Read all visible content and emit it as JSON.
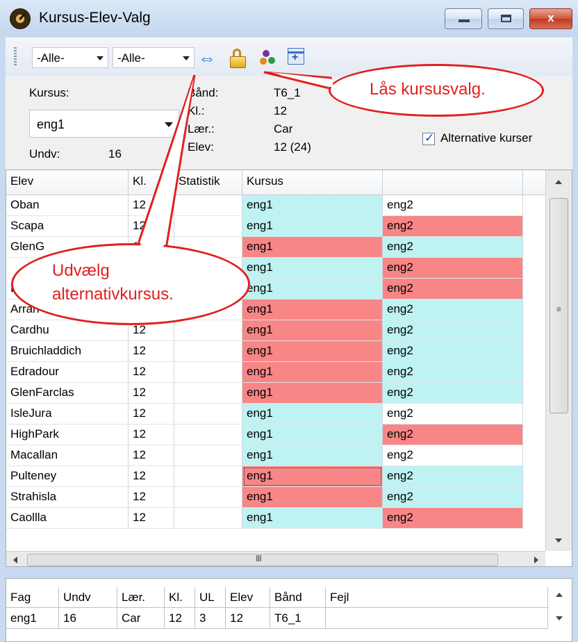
{
  "window": {
    "title": "Kursus-Elev-Valg",
    "close_glyph": "x"
  },
  "toolbar": {
    "filter1": "-Alle-",
    "filter2": "-Alle-",
    "icons": [
      "swap-arrows-icon",
      "lock-icon",
      "users-icon",
      "grid-expand-icon"
    ]
  },
  "info": {
    "kursus_label": "Kursus:",
    "kursus_value": "eng1",
    "undv_label": "Undv:",
    "undv_value": "16",
    "band_label": "Bånd:",
    "band_value": "T6_1",
    "kl_label": "Kl.:",
    "kl_value": "12",
    "laer_label": "Lær.:",
    "laer_value": "Car",
    "elev_label": "Elev:",
    "elev_value": "12 (24)",
    "alt_checkbox_label": "Alternative kurser",
    "alt_checked": true
  },
  "grid": {
    "headers": [
      "Elev",
      "Kl.",
      "Statistik",
      "Kursus",
      ""
    ],
    "rows": [
      {
        "elev": "Oban",
        "kl": "12",
        "stat": "",
        "kursus": "eng1",
        "alt": "eng2",
        "c1": "cyan",
        "c2": "white"
      },
      {
        "elev": "Scapa",
        "kl": "12",
        "stat": "",
        "kursus": "eng1",
        "alt": "eng2",
        "c1": "cyan",
        "c2": "red"
      },
      {
        "elev": "GlenG",
        "kl": "12",
        "stat": "",
        "kursus": "eng1",
        "alt": "eng2",
        "c1": "red",
        "c2": "cyan"
      },
      {
        "elev": "",
        "kl": "12",
        "stat": "",
        "kursus": "eng1",
        "alt": "eng2",
        "c1": "cyan",
        "c2": "red"
      },
      {
        "elev": "B",
        "kl": "12",
        "stat": "",
        "kursus": "eng1",
        "alt": "eng2",
        "c1": "cyan",
        "c2": "red"
      },
      {
        "elev": "Arran",
        "kl": "12",
        "stat": "",
        "kursus": "eng1",
        "alt": "eng2",
        "c1": "red",
        "c2": "cyan"
      },
      {
        "elev": "Cardhu",
        "kl": "12",
        "stat": "",
        "kursus": "eng1",
        "alt": "eng2",
        "c1": "red",
        "c2": "cyan"
      },
      {
        "elev": "Bruichladdich",
        "kl": "12",
        "stat": "",
        "kursus": "eng1",
        "alt": "eng2",
        "c1": "red",
        "c2": "cyan"
      },
      {
        "elev": "Edradour",
        "kl": "12",
        "stat": "",
        "kursus": "eng1",
        "alt": "eng2",
        "c1": "red",
        "c2": "cyan"
      },
      {
        "elev": "GlenFarclas",
        "kl": "12",
        "stat": "",
        "kursus": "eng1",
        "alt": "eng2",
        "c1": "red",
        "c2": "cyan"
      },
      {
        "elev": "IsleJura",
        "kl": "12",
        "stat": "",
        "kursus": "eng1",
        "alt": "eng2",
        "c1": "cyan",
        "c2": "white"
      },
      {
        "elev": "HighPark",
        "kl": "12",
        "stat": "",
        "kursus": "eng1",
        "alt": "eng2",
        "c1": "cyan",
        "c2": "red"
      },
      {
        "elev": "Macallan",
        "kl": "12",
        "stat": "",
        "kursus": "eng1",
        "alt": "eng2",
        "c1": "cyan",
        "c2": "white"
      },
      {
        "elev": "Pulteney",
        "kl": "12",
        "stat": "",
        "kursus": "eng1",
        "alt": "eng2",
        "c1": "red",
        "c2": "cyan",
        "focus": true
      },
      {
        "elev": "Strahisla",
        "kl": "12",
        "stat": "",
        "kursus": "eng1",
        "alt": "eng2",
        "c1": "red",
        "c2": "cyan"
      },
      {
        "elev": "Caollla",
        "kl": "12",
        "stat": "",
        "kursus": "eng1",
        "alt": "eng2",
        "c1": "cyan",
        "c2": "red"
      }
    ],
    "hscroll_grip": "III"
  },
  "bottom_grid": {
    "headers": [
      "Fag",
      "Undv",
      "Lær.",
      "Kl.",
      "UL",
      "Elev",
      "Bånd",
      "Fejl"
    ],
    "row": [
      "eng1",
      "16",
      "Car",
      "12",
      "3",
      "12",
      "T6_1",
      ""
    ]
  },
  "callouts": {
    "lock": "Lås kursusvalg.",
    "alt_line1": "Udvælg",
    "alt_line2": "alternativkursus."
  },
  "colors": {
    "cyan": "#bff2f2",
    "red": "#f88686",
    "callout": "#e02020"
  }
}
